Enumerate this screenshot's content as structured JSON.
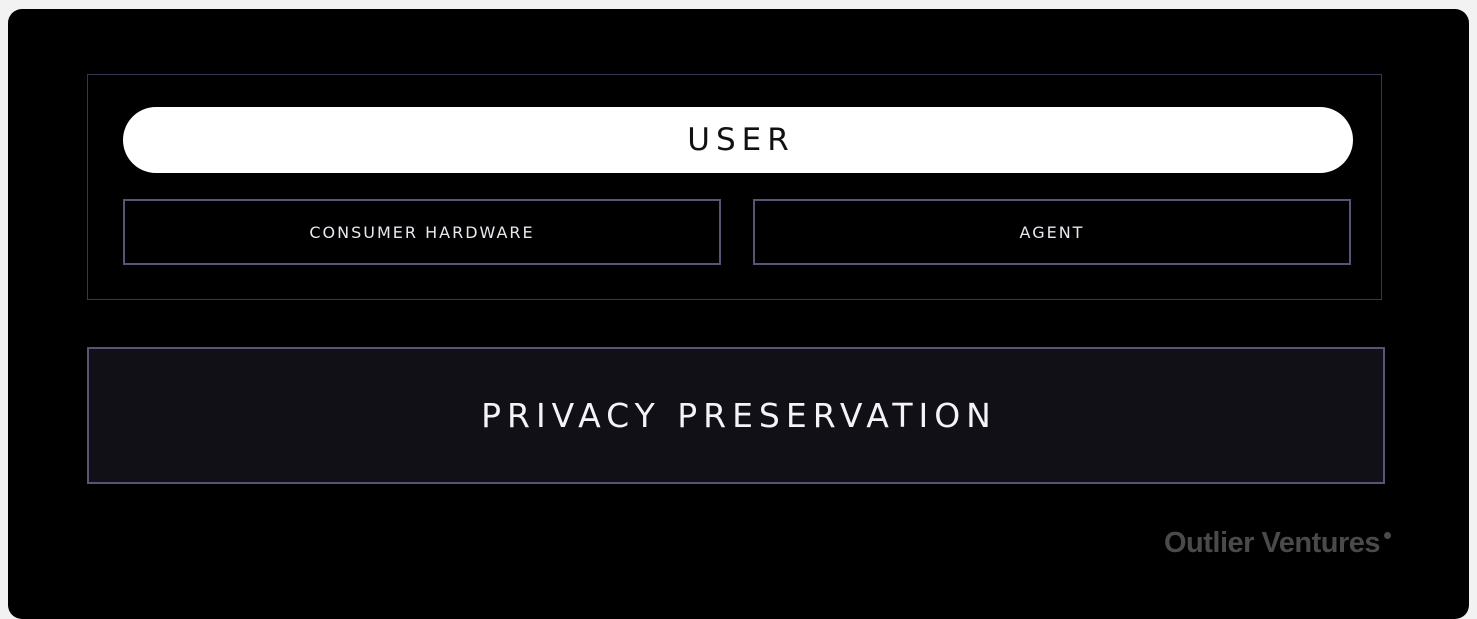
{
  "diagram": {
    "top_layer": {
      "label": "USER",
      "components": [
        {
          "label": "CONSUMER HARDWARE"
        },
        {
          "label": "AGENT"
        }
      ]
    },
    "base_layer": {
      "label": "PRIVACY PRESERVATION"
    }
  },
  "branding": {
    "logo_text": "Outlier Ventures"
  },
  "colors": {
    "background": "#000000",
    "pill": "#ffffff",
    "box_border": "#5b5275",
    "frame_border": "#3a3550",
    "base_fill": "#111016",
    "brand_text": "#4a4a4a"
  }
}
